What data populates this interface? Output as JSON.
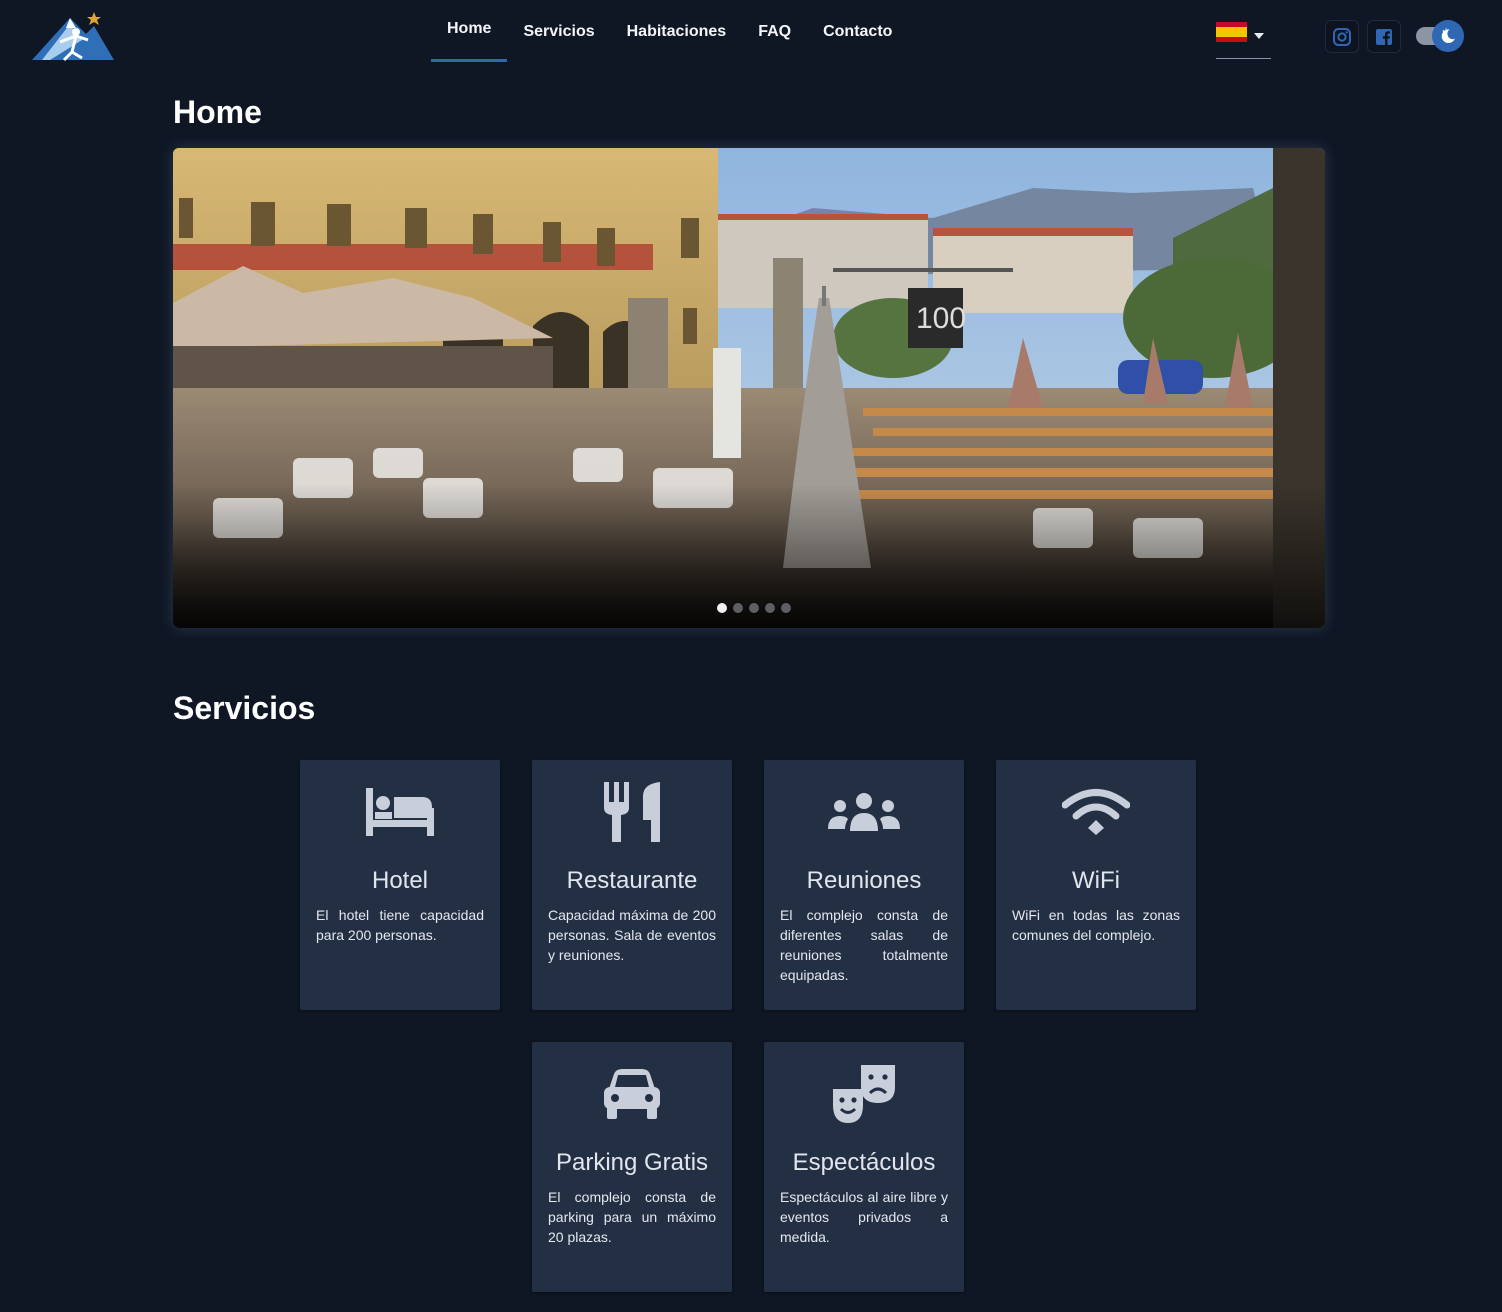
{
  "header": {
    "nav": [
      "Home",
      "Servicios",
      "Habitaciones",
      "FAQ",
      "Contacto"
    ],
    "active_nav": "Home",
    "language_flag": "es-flag",
    "social": [
      "instagram-icon",
      "facebook-icon"
    ],
    "theme_toggle": "dark-mode-moon-icon"
  },
  "home": {
    "title": "Home",
    "carousel": {
      "slide_count": 5,
      "active_slide": 1,
      "image_description": "hotel-terrace-with-tables-and-mountains"
    }
  },
  "services": {
    "title": "Servicios",
    "cards": [
      {
        "icon": "bed-icon",
        "title": "Hotel",
        "desc": "El hotel tiene capacidad para 200 personas."
      },
      {
        "icon": "utensils-icon",
        "title": "Restaurante",
        "desc": "Capacidad máxima de 200 personas. Sala de eventos y reuniones."
      },
      {
        "icon": "users-icon",
        "title": "Reuniones",
        "desc": "El complejo consta de diferentes salas de reuniones totalmente equipadas."
      },
      {
        "icon": "wifi-icon",
        "title": "WiFi",
        "desc": "WiFi en todas las zonas comunes del complejo."
      },
      {
        "icon": "car-icon",
        "title": "Parking Gratis",
        "desc": "El complejo consta de parking para un máximo 20 plazas."
      },
      {
        "icon": "theater-masks-icon",
        "title": "Espectáculos",
        "desc": "Espectáculos al aire libre y eventos privados a medida."
      }
    ]
  },
  "colors": {
    "background": "#0f1724",
    "card": "#233044",
    "accent": "#3466a8",
    "icon": "#c9cfda"
  }
}
